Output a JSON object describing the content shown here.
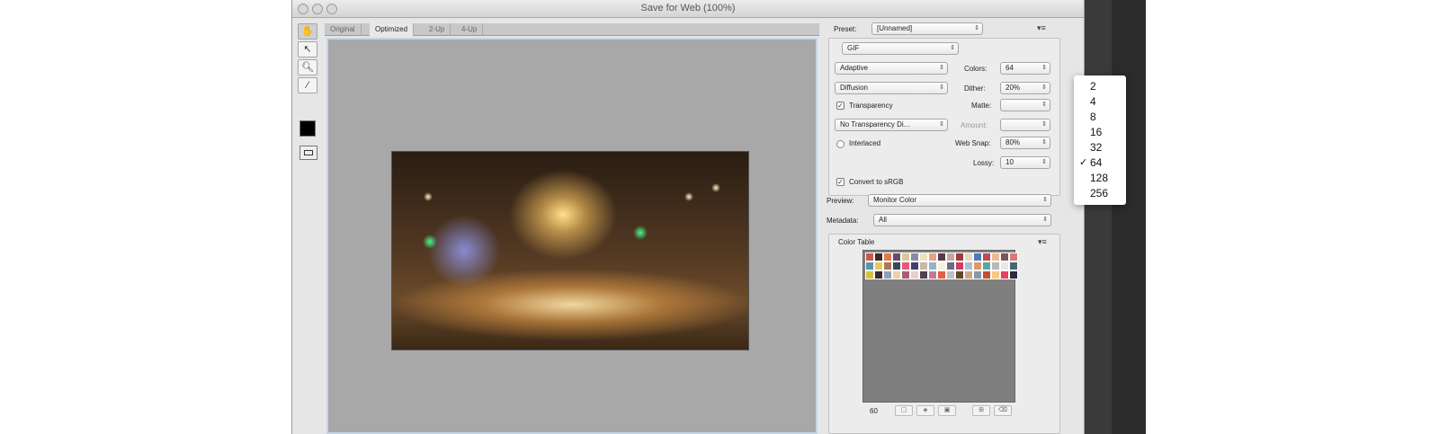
{
  "window": {
    "title": "Save for Web (100%)"
  },
  "tabs": [
    {
      "label": "Original"
    },
    {
      "label": "Optimized"
    },
    {
      "label": "2-Up"
    },
    {
      "label": "4-Up"
    }
  ],
  "toolbox": {
    "tools": [
      "hand-tool",
      "slice-select-tool",
      "zoom-tool",
      "eyedropper-tool"
    ],
    "eyedropper_color": "#000000"
  },
  "settings": {
    "preset_label": "Preset:",
    "preset_value": "[Unnamed]",
    "format": "GIF",
    "reduction": "Adaptive",
    "colors_label": "Colors:",
    "colors_value": "64",
    "dither_algo": "Diffusion",
    "dither_label": "Dither:",
    "dither_value": "20%",
    "transparency_label": "Transparency",
    "transparency_checked": true,
    "matte_label": "Matte:",
    "matte_value": "",
    "transparency_dither": "No Transparency Di...",
    "amount_label": "Amount:",
    "amount_value": "",
    "interlaced_label": "Interlaced",
    "websnap_label": "Web Snap:",
    "websnap_value": "80%",
    "lossy_label": "Lossy:",
    "lossy_value": "10",
    "convert_srgb_label": "Convert to sRGB",
    "convert_srgb_checked": true,
    "preview_label": "Preview:",
    "preview_value": "Monitor Color",
    "metadata_label": "Metadata:",
    "metadata_value": "All"
  },
  "color_table": {
    "title": "Color Table",
    "count": "60",
    "colors": [
      "#c85a48",
      "#3a2a2a",
      "#e07a4a",
      "#6a4a6a",
      "#d8c8a0",
      "#8a8aa8",
      "#f0e0c0",
      "#e8a080",
      "#58384a",
      "#c0a8a0",
      "#a03840",
      "#e8d8b8",
      "#4a7ab8",
      "#c04858",
      "#f0b890",
      "#7a5858",
      "#d87878",
      "#5898a8",
      "#e8c860",
      "#a87858",
      "#384858",
      "#e85878",
      "#404070",
      "#c8b8a8",
      "#8ab8c8",
      "#f8f0d8",
      "#6a6a88",
      "#d04060",
      "#a8c0d8",
      "#e09868",
      "#58a8a0",
      "#b8b8b8",
      "#e8e8e8",
      "#486878",
      "#d8c040",
      "#382838",
      "#90a0b8",
      "#f0d0a8",
      "#a86070",
      "#e8d0c8",
      "#504050",
      "#c87898",
      "#e06040",
      "#c0c0c0",
      "#604830",
      "#d0a880",
      "#8898a8",
      "#c05030",
      "#f8c880",
      "#e84060",
      "#2a2a3a"
    ]
  },
  "colors_popup": {
    "options": [
      "2",
      "4",
      "8",
      "16",
      "32",
      "64",
      "128",
      "256"
    ],
    "selected": "64"
  }
}
